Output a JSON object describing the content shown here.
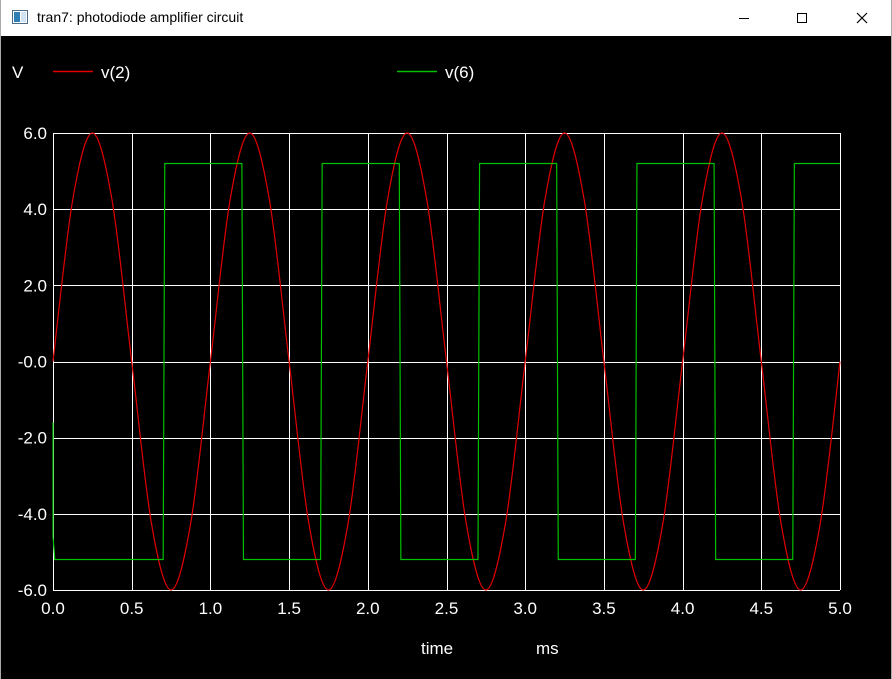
{
  "window": {
    "title": "tran7: photodiode amplifier circuit",
    "icons": [
      "app-icon",
      "minimize-icon",
      "maximize-icon",
      "close-icon"
    ]
  },
  "chart_data": {
    "type": "line",
    "ylabel": "V",
    "xlabel": "time",
    "xunit": "ms",
    "xlim": [
      0.0,
      5.0
    ],
    "ylim": [
      -6.0,
      6.0
    ],
    "xticks": [
      "0.0",
      "0.5",
      "1.0",
      "1.5",
      "2.0",
      "2.5",
      "3.0",
      "3.5",
      "4.0",
      "4.5",
      "5.0"
    ],
    "yticks": [
      "6.0",
      "4.0",
      "2.0",
      "-0.0",
      "-2.0",
      "-4.0",
      "-6.0"
    ],
    "grid": true,
    "legend_placement": "top",
    "colors": {
      "background": "#000000",
      "grid": "#ffffff",
      "text": "#ffffff"
    },
    "series": [
      {
        "name": "v(2)",
        "color": "#e00000",
        "x": [
          0.0,
          0.125,
          0.25,
          0.375,
          0.5,
          0.625,
          0.75,
          0.875,
          1.0,
          1.125,
          1.25,
          1.375,
          1.5,
          1.625,
          1.75,
          1.875,
          2.0,
          2.125,
          2.25,
          2.375,
          2.5,
          2.625,
          2.75,
          2.875,
          3.0,
          3.125,
          3.25,
          3.375,
          3.5,
          3.625,
          3.75,
          3.875,
          4.0,
          4.125,
          4.25,
          4.375,
          4.5,
          4.625,
          4.75,
          4.875,
          5.0
        ],
        "y": [
          0.0,
          4.24,
          6.0,
          4.24,
          0.0,
          -4.24,
          -6.0,
          -4.24,
          0.0,
          4.24,
          6.0,
          4.24,
          0.0,
          -4.24,
          -6.0,
          -4.24,
          0.0,
          4.24,
          6.0,
          4.24,
          0.0,
          -4.24,
          -6.0,
          -4.24,
          0.0,
          4.24,
          6.0,
          4.24,
          0.0,
          -4.24,
          -6.0,
          -4.24,
          0.0,
          4.24,
          6.0,
          4.24,
          0.0,
          -4.24,
          -6.0,
          -4.24,
          0.0
        ]
      },
      {
        "name": "v(6)",
        "color": "#00c000",
        "x": [
          0.0,
          0.0,
          0.01,
          0.01,
          0.7,
          0.71,
          1.2,
          1.21,
          1.7,
          1.71,
          2.2,
          2.21,
          2.7,
          2.71,
          3.2,
          3.21,
          3.7,
          3.71,
          4.2,
          4.21,
          4.7,
          4.71,
          5.0
        ],
        "y": [
          -1.6,
          -4.6,
          -5.1,
          -5.2,
          -5.2,
          5.2,
          5.2,
          -5.2,
          -5.2,
          5.2,
          5.2,
          -5.2,
          -5.2,
          5.2,
          5.2,
          -5.2,
          -5.2,
          5.2,
          5.2,
          -5.2,
          -5.2,
          5.2,
          5.2
        ]
      }
    ]
  }
}
